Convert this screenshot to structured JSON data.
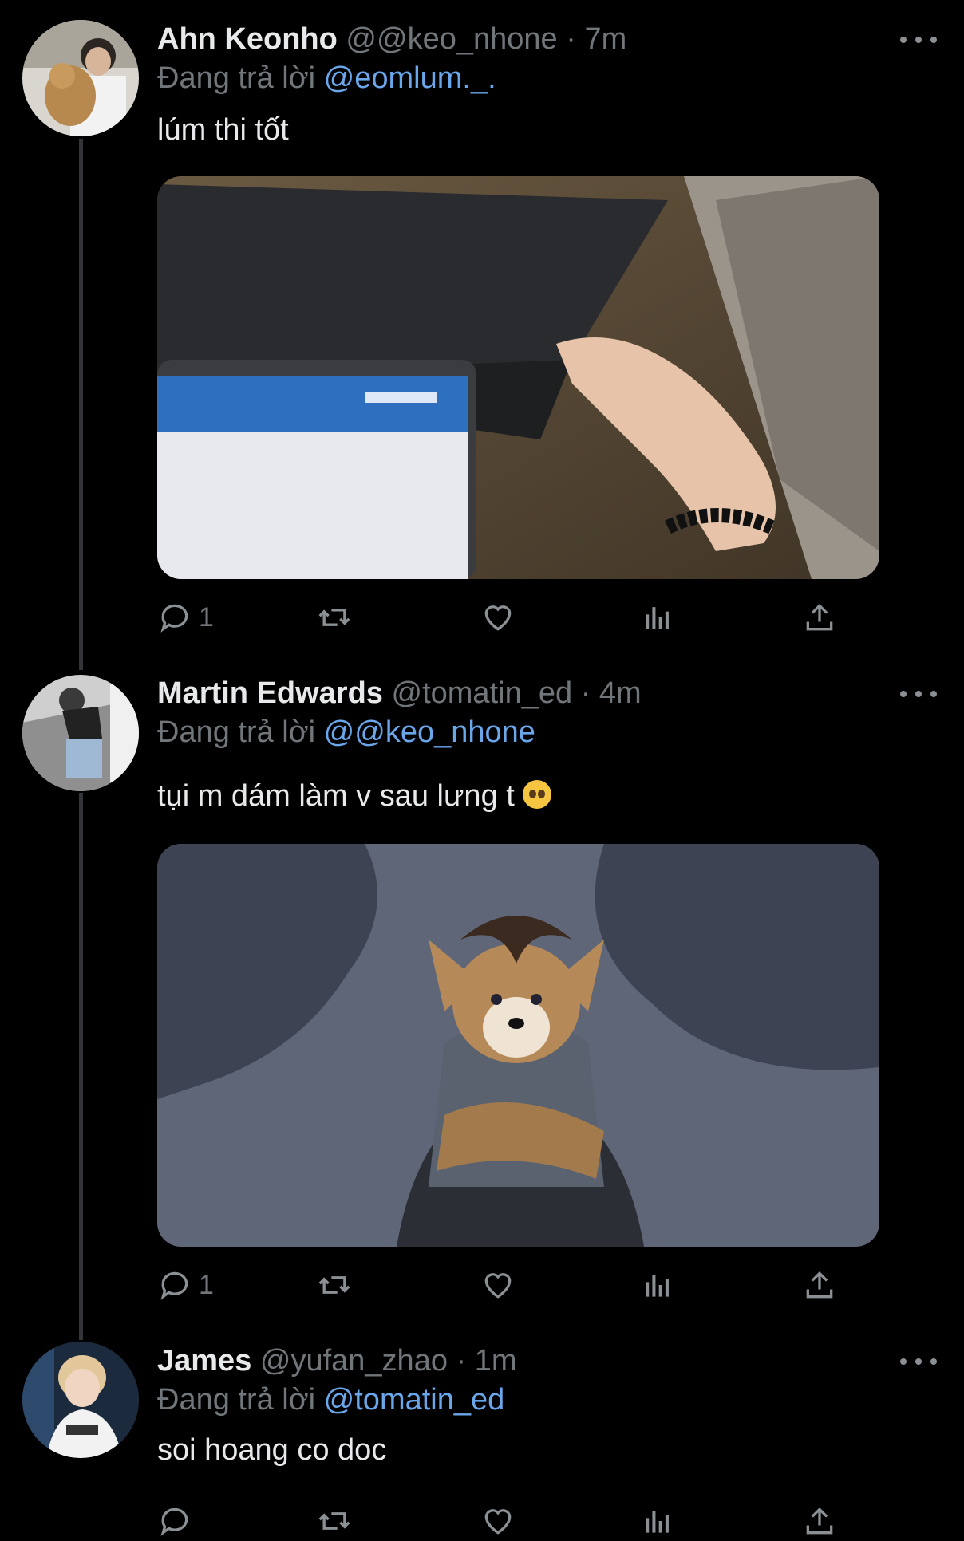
{
  "tweets": [
    {
      "name": "Ahn Keonho",
      "handle": "@@keo_nhone",
      "dot": "·",
      "time": "7m",
      "reply_prefix": "Đang trả lời",
      "reply_to": "@eomlum._.",
      "text": "lúm thi tốt",
      "media_alt": "laptop on wooden table with hand",
      "replies": "1"
    },
    {
      "name": "Martin Edwards",
      "handle": "@tomatin_ed",
      "dot": "·",
      "time": "4m",
      "reply_prefix": "Đang trả lời",
      "reply_to": "@@keo_nhone",
      "text": "tụi m dám làm v sau lưng t",
      "emoji": "pleading-face-emoji",
      "media_alt": "cartoon fox character with crossed arms",
      "replies": "1"
    },
    {
      "name": "James",
      "handle": "@yufan_zhao",
      "dot": "·",
      "time": "1m",
      "reply_prefix": "Đang trả lời",
      "reply_to": "@tomatin_ed",
      "text": "soi hoang co doc",
      "replies": ""
    }
  ],
  "colors": {
    "background": "#000000",
    "text": "#e7e9ea",
    "secondary": "#71767b",
    "link": "#6aa6ea",
    "thread_line": "#333639"
  },
  "icons": [
    "reply-icon",
    "retweet-icon",
    "like-icon",
    "views-icon",
    "share-icon",
    "more-icon"
  ]
}
